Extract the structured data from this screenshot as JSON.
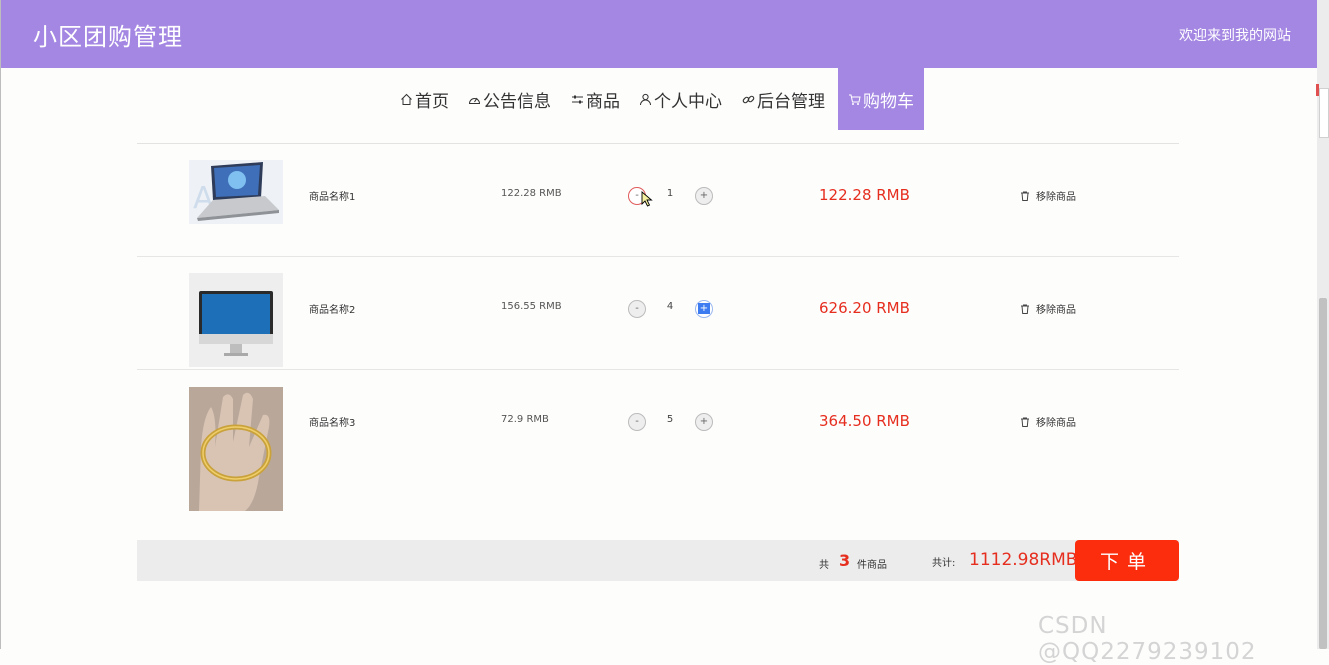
{
  "header": {
    "site_title": "小区团购管理",
    "welcome": "欢迎来到我的网站"
  },
  "nav": [
    {
      "label": "首页",
      "icon": "home-icon"
    },
    {
      "label": "公告信息",
      "icon": "dashboard-icon"
    },
    {
      "label": "商品",
      "icon": "sliders-icon"
    },
    {
      "label": "个人中心",
      "icon": "user-icon"
    },
    {
      "label": "后台管理",
      "icon": "link-icon"
    },
    {
      "label": "购物车",
      "icon": "cart-icon",
      "active": true
    }
  ],
  "cart": {
    "items": [
      {
        "name": "商品名称1",
        "unit_price": "122.28 RMB",
        "qty_minus": "-",
        "qty": "1",
        "qty_plus": "+",
        "subtotal": "122.28 RMB",
        "remove": "移除商品",
        "image": "laptop-image"
      },
      {
        "name": "商品名称2",
        "unit_price": "156.55 RMB",
        "qty_minus": "-",
        "qty": "4",
        "qty_plus": "+",
        "subtotal": "626.20 RMB",
        "remove": "移除商品",
        "image": "monitor-image"
      },
      {
        "name": "商品名称3",
        "unit_price": "72.9 RMB",
        "qty_minus": "-",
        "qty": "5",
        "qty_plus": "+",
        "subtotal": "364.50 RMB",
        "remove": "移除商品",
        "image": "bracelet-image"
      }
    ]
  },
  "summary": {
    "gong": "共",
    "count": "3",
    "jian": "件商品",
    "total_label": "共计:",
    "total": "1112.98RMB",
    "order_button": "下单"
  },
  "watermark": "CSDN @QQ2279239102",
  "colors": {
    "header": "#a487e2",
    "accent_red": "#e62e1f",
    "order_button": "#fc2d0d"
  }
}
